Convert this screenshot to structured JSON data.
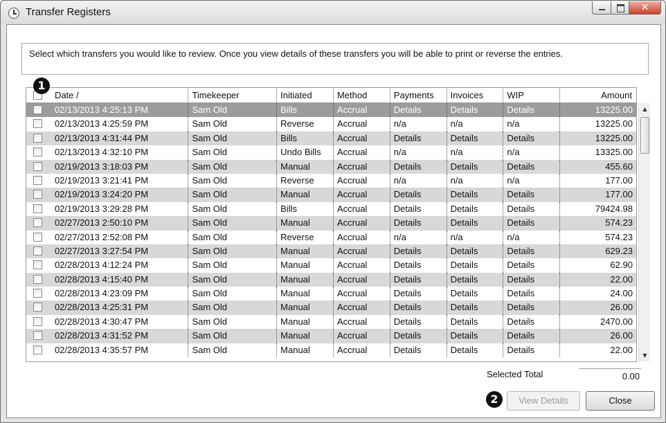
{
  "window": {
    "title": "Transfer Registers"
  },
  "instructions": "Select which transfers you would like to review. Once you view details of these transfers you will be able to print or reverse the entries.",
  "columns": [
    "Date /",
    "Timekeeper",
    "Initiated",
    "Method",
    "Payments",
    "Invoices",
    "WIP",
    "Amount"
  ],
  "rows": [
    {
      "date": "02/13/2013 4:25:13 PM",
      "timekeeper": "Sam Old",
      "initiated": "Bills",
      "method": "Accrual",
      "payments": "Details",
      "invoices": "Details",
      "wip": "Details",
      "amount": "13225.00"
    },
    {
      "date": "02/13/2013 4:25:59 PM",
      "timekeeper": "Sam Old",
      "initiated": "Reverse",
      "method": "Accrual",
      "payments": "n/a",
      "invoices": "n/a",
      "wip": "n/a",
      "amount": "13225.00"
    },
    {
      "date": "02/13/2013 4:31:44 PM",
      "timekeeper": "Sam Old",
      "initiated": "Bills",
      "method": "Accrual",
      "payments": "Details",
      "invoices": "Details",
      "wip": "Details",
      "amount": "13225.00"
    },
    {
      "date": "02/13/2013 4:32:10 PM",
      "timekeeper": "Sam Old",
      "initiated": "Undo Bills",
      "method": "Accrual",
      "payments": "n/a",
      "invoices": "n/a",
      "wip": "n/a",
      "amount": "13325.00"
    },
    {
      "date": "02/19/2013 3:18:03 PM",
      "timekeeper": "Sam Old",
      "initiated": "Manual",
      "method": "Accrual",
      "payments": "Details",
      "invoices": "Details",
      "wip": "Details",
      "amount": "455.60"
    },
    {
      "date": "02/19/2013 3:21:41 PM",
      "timekeeper": "Sam Old",
      "initiated": "Reverse",
      "method": "Accrual",
      "payments": "n/a",
      "invoices": "n/a",
      "wip": "n/a",
      "amount": "177.00"
    },
    {
      "date": "02/19/2013 3:24:20 PM",
      "timekeeper": "Sam Old",
      "initiated": "Manual",
      "method": "Accrual",
      "payments": "Details",
      "invoices": "Details",
      "wip": "Details",
      "amount": "177.00"
    },
    {
      "date": "02/19/2013 3:29:28 PM",
      "timekeeper": "Sam Old",
      "initiated": "Bills",
      "method": "Accrual",
      "payments": "Details",
      "invoices": "Details",
      "wip": "Details",
      "amount": "79424.98"
    },
    {
      "date": "02/27/2013 2:50:10 PM",
      "timekeeper": "Sam Old",
      "initiated": "Manual",
      "method": "Accrual",
      "payments": "Details",
      "invoices": "Details",
      "wip": "Details",
      "amount": "574.23"
    },
    {
      "date": "02/27/2013 2:52:08 PM",
      "timekeeper": "Sam Old",
      "initiated": "Reverse",
      "method": "Accrual",
      "payments": "n/a",
      "invoices": "n/a",
      "wip": "n/a",
      "amount": "574.23"
    },
    {
      "date": "02/27/2013 3:27:54 PM",
      "timekeeper": "Sam Old",
      "initiated": "Manual",
      "method": "Accrual",
      "payments": "Details",
      "invoices": "Details",
      "wip": "Details",
      "amount": "629.23"
    },
    {
      "date": "02/28/2013 4:12:24 PM",
      "timekeeper": "Sam Old",
      "initiated": "Manual",
      "method": "Accrual",
      "payments": "Details",
      "invoices": "Details",
      "wip": "Details",
      "amount": "62.90"
    },
    {
      "date": "02/28/2013 4:15:40 PM",
      "timekeeper": "Sam Old",
      "initiated": "Manual",
      "method": "Accrual",
      "payments": "Details",
      "invoices": "Details",
      "wip": "Details",
      "amount": "22.00"
    },
    {
      "date": "02/28/2013 4:23:09 PM",
      "timekeeper": "Sam Old",
      "initiated": "Manual",
      "method": "Accrual",
      "payments": "Details",
      "invoices": "Details",
      "wip": "Details",
      "amount": "24.00"
    },
    {
      "date": "02/28/2013 4:25:31 PM",
      "timekeeper": "Sam Old",
      "initiated": "Manual",
      "method": "Accrual",
      "payments": "Details",
      "invoices": "Details",
      "wip": "Details",
      "amount": "26.00"
    },
    {
      "date": "02/28/2013 4:30:47 PM",
      "timekeeper": "Sam Old",
      "initiated": "Manual",
      "method": "Accrual",
      "payments": "Details",
      "invoices": "Details",
      "wip": "Details",
      "amount": "2470.00"
    },
    {
      "date": "02/28/2013 4:31:52 PM",
      "timekeeper": "Sam Old",
      "initiated": "Manual",
      "method": "Accrual",
      "payments": "Details",
      "invoices": "Details",
      "wip": "Details",
      "amount": "26.00"
    },
    {
      "date": "02/28/2013 4:35:57 PM",
      "timekeeper": "Sam Old",
      "initiated": "Manual",
      "method": "Accrual",
      "payments": "Details",
      "invoices": "Details",
      "wip": "Details",
      "amount": "22.00"
    }
  ],
  "footer": {
    "selected_total_label": "Selected Total",
    "selected_total_value": "0.00",
    "view_details_label": "View Details",
    "close_label": "Close"
  },
  "callouts": {
    "one": "1",
    "two": "2"
  },
  "icons": {
    "title": "clock-icon",
    "scroll_up": "scroll-up-arrow-icon",
    "scroll_down": "scroll-down-arrow-icon"
  },
  "colors": {
    "selected_row": "#9c9c9c",
    "shaded_row": "#d8d8d8",
    "close_button": "#c8412a"
  }
}
